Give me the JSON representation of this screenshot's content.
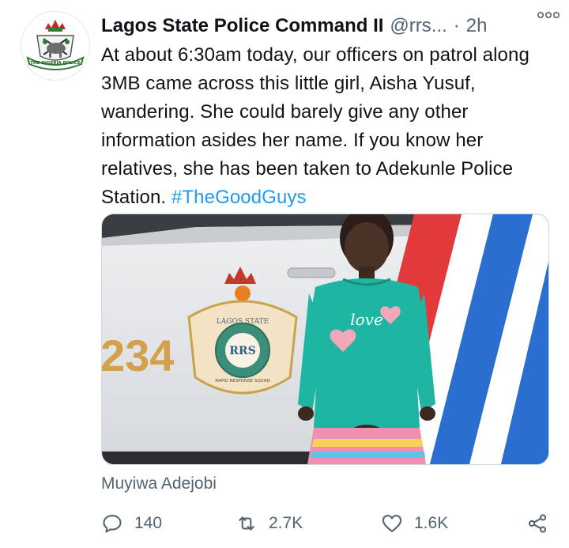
{
  "tweet": {
    "display_name": "Lagos State Police Command II",
    "handle": "@rrs...",
    "separator": "·",
    "timestamp": "2h",
    "more_icon": "more-options-icon",
    "text": "At about 6:30am today, our officers on patrol along 3MB came across this little girl, Aisha Yusuf, wandering. She could barely give any other information asides her name. If you know her relatives, she has been taken to Adekunle Police Station.",
    "hashtag": "#TheGoodGuys",
    "avatar_badge_text": "THE NIGERIA POLICE",
    "media": {
      "car_number": "234",
      "badge_top_text": "LAGOS STATE",
      "badge_ring_text": "RAPID RESPONSE SQUAD",
      "badge_center_text": "RRS",
      "shirt_text": "love"
    },
    "photo_credit": "Muyiwa Adejobi"
  },
  "actions": {
    "replies": "140",
    "retweets": "2.7K",
    "likes": "1.6K"
  },
  "colors": {
    "accent": "#1d9bf0",
    "secondary_text": "#536471",
    "shirt": "#1fb5a3"
  }
}
